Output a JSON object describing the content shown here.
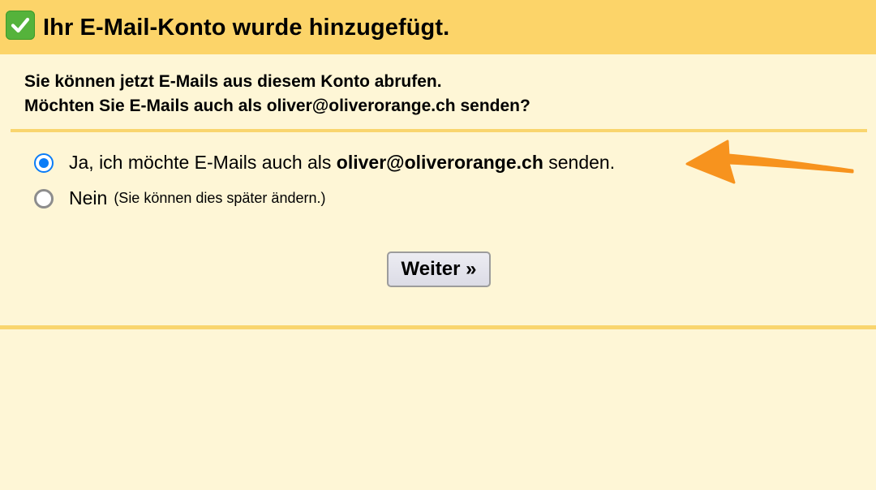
{
  "header": {
    "title": "Ihr E-Mail-Konto wurde hinzugefügt."
  },
  "intro": {
    "line1": "Sie können jetzt E-Mails aus diesem Konto abrufen.",
    "line2": "Möchten Sie E-Mails auch als oliver@oliverorange.ch senden?"
  },
  "options": [
    {
      "prefix": "Ja, ich möchte E-Mails auch als ",
      "email": "oliver@oliverorange.ch",
      "suffix": " senden.",
      "selected": true
    },
    {
      "label": "Nein",
      "note": "(Sie können dies später ändern.)",
      "selected": false
    }
  ],
  "next_button": {
    "label": "Weiter »"
  },
  "colors": {
    "header_bg": "#fcd469",
    "page_bg": "#fef6d6",
    "divider": "#f9d56e",
    "radio_selected": "#0a7cf7",
    "check_green": "#55b33b",
    "annotation_arrow": "#f7931e"
  },
  "icons": {
    "header_icon": "checkmark-icon",
    "annotation": "arrow-left-icon"
  }
}
